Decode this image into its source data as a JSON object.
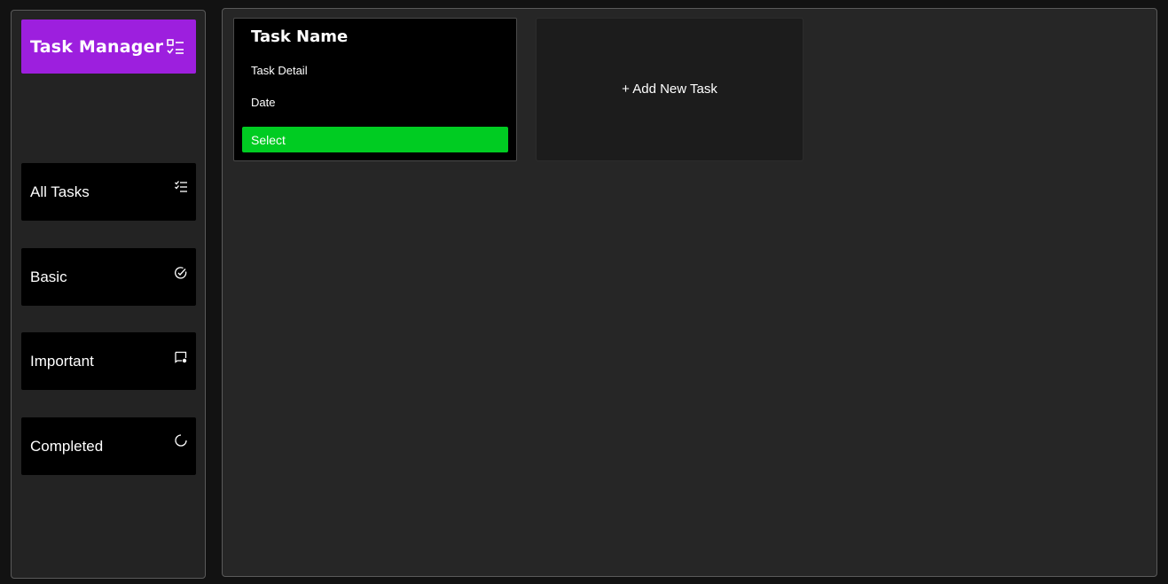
{
  "brand": {
    "title": "Task Manager",
    "icon": "task-list-icon",
    "color": "#9d1fde"
  },
  "sidebar": {
    "items": [
      {
        "label": "All Tasks",
        "icon": "list-check-icon"
      },
      {
        "label": "Basic",
        "icon": "circle-check-icon"
      },
      {
        "label": "Important",
        "icon": "chat-important-icon"
      },
      {
        "label": "Completed",
        "icon": "spinner-icon"
      }
    ]
  },
  "task": {
    "name": "Task Name",
    "detail": "Task Detail",
    "date": "Date",
    "select_label": "Select",
    "select_color": "#00cc22"
  },
  "add_task": {
    "label": "+ Add New Task"
  }
}
